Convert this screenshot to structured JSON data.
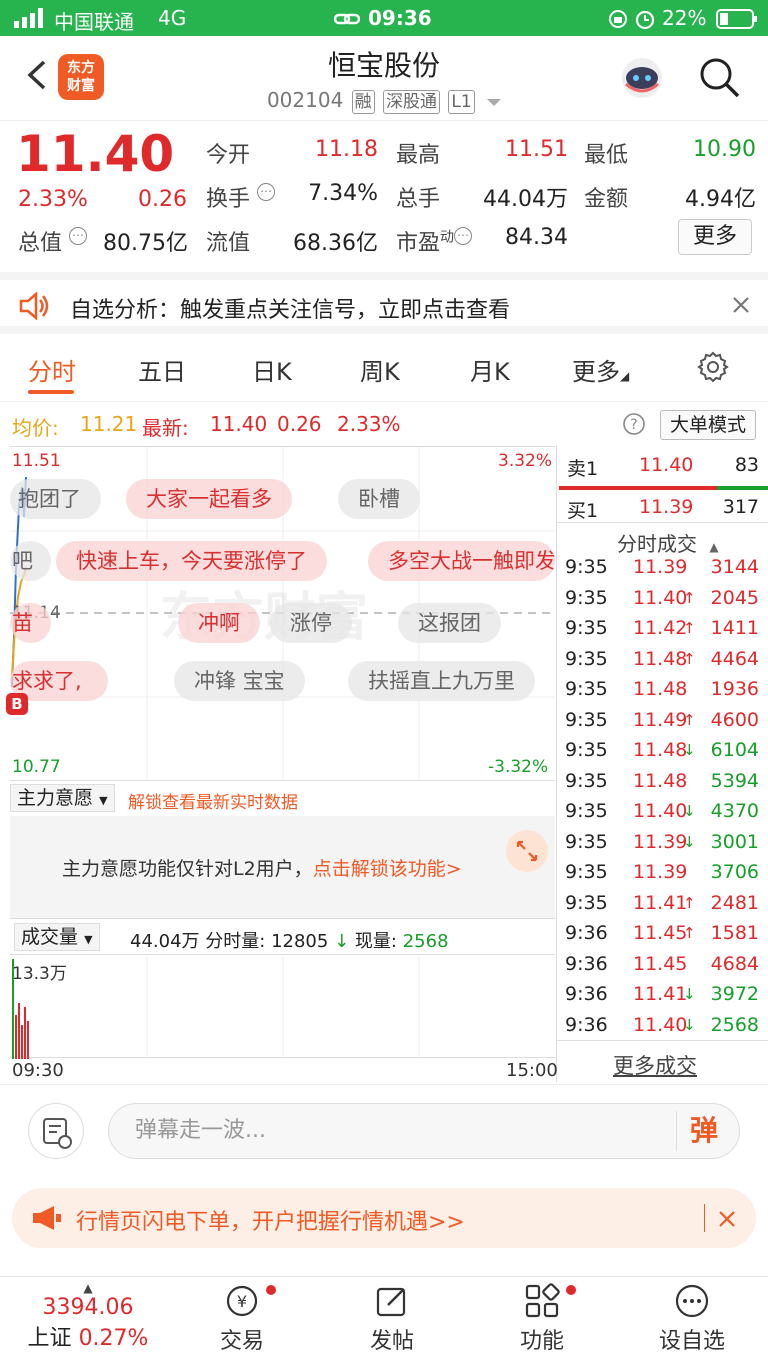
{
  "status": {
    "carrier": "中国联通",
    "network": "4G",
    "time": "09:36",
    "battery": "22%"
  },
  "header": {
    "logo_line1": "东方",
    "logo_line2": "财富",
    "title": "恒宝股份",
    "code": "002104",
    "tags": [
      "融",
      "深股通",
      "L1"
    ]
  },
  "quote": {
    "price": "11.40",
    "pct": "2.33%",
    "chg": "0.26",
    "rows": [
      [
        {
          "label": "今开",
          "value": "11.18",
          "color": "red"
        },
        {
          "label": "最高",
          "value": "11.51",
          "color": "red"
        },
        {
          "label": "最低",
          "value": "10.90",
          "color": "green"
        }
      ],
      [
        {
          "label": "换手",
          "value": "7.34%",
          "color": "black",
          "info": true
        },
        {
          "label": "总手",
          "value": "44.04万",
          "color": "black"
        },
        {
          "label": "金额",
          "value": "4.94亿",
          "color": "black"
        }
      ]
    ],
    "total_label": "总值",
    "total_value": "80.75亿",
    "float_label": "流值",
    "float_value": "68.36亿",
    "pe_label": "市盈",
    "pe_sup": "动",
    "pe_value": "84.34",
    "more_label": "更多"
  },
  "analysis": {
    "text": "自选分析：触发重点关注信号，立即点击查看"
  },
  "tabs": [
    {
      "label": "分时",
      "active": true
    },
    {
      "label": "五日"
    },
    {
      "label": "日K"
    },
    {
      "label": "周K"
    },
    {
      "label": "月K"
    },
    {
      "label": "更多"
    }
  ],
  "avgline": {
    "avg_label": "均价:",
    "avg_value": "11.21",
    "last_label": "最新:",
    "last_value": "11.40",
    "last_chg": "0.26",
    "last_pct": "2.33%",
    "bigmode": "大单模式"
  },
  "chart": {
    "high": "11.51",
    "low": "10.77",
    "high_pct": "3.32%",
    "low_pct": "-3.32%",
    "mid": "11.14",
    "buy_marker": "B",
    "watermark": "东方财富",
    "danmu": [
      {
        "text": "抱团了",
        "style": "grey"
      },
      {
        "text": "大家一起看多",
        "style": "pink"
      },
      {
        "text": "卧槽",
        "style": "grey"
      },
      {
        "text": "吧",
        "style": "grey"
      },
      {
        "text": "快速上车，今天要涨停了",
        "style": "pink"
      },
      {
        "text": "多空大战一触即发",
        "style": "pink"
      },
      {
        "text": "苗",
        "style": "pink"
      },
      {
        "text": "冲啊",
        "style": "pink"
      },
      {
        "text": "涨停",
        "style": "grey"
      },
      {
        "text": "这报团",
        "style": "grey"
      },
      {
        "text": "求求了,",
        "style": "pink"
      },
      {
        "text": "冲锋  宝宝",
        "style": "grey"
      },
      {
        "text": "扶摇直上九万里",
        "style": "grey"
      }
    ]
  },
  "book": {
    "sell_label": "卖1",
    "sell_price": "11.40",
    "sell_vol": "83",
    "buy_label": "买1",
    "buy_price": "11.39",
    "buy_vol": "317",
    "trades_title": "分时成交",
    "trades": [
      {
        "time": "9:35",
        "price": "11.39",
        "arrow": "",
        "vol": "3144",
        "pc": "red",
        "vc": "red"
      },
      {
        "time": "9:35",
        "price": "11.40",
        "arrow": "↑",
        "vol": "2045",
        "pc": "red",
        "vc": "red"
      },
      {
        "time": "9:35",
        "price": "11.42",
        "arrow": "↑",
        "vol": "1411",
        "pc": "red",
        "vc": "red"
      },
      {
        "time": "9:35",
        "price": "11.48",
        "arrow": "↑",
        "vol": "4464",
        "pc": "red",
        "vc": "red"
      },
      {
        "time": "9:35",
        "price": "11.48",
        "arrow": "",
        "vol": "1936",
        "pc": "red",
        "vc": "red"
      },
      {
        "time": "9:35",
        "price": "11.49",
        "arrow": "↑",
        "vol": "4600",
        "pc": "red",
        "vc": "red"
      },
      {
        "time": "9:35",
        "price": "11.48",
        "arrow": "↓",
        "vol": "6104",
        "pc": "red",
        "vc": "green"
      },
      {
        "time": "9:35",
        "price": "11.48",
        "arrow": "",
        "vol": "5394",
        "pc": "red",
        "vc": "green"
      },
      {
        "time": "9:35",
        "price": "11.40",
        "arrow": "↓",
        "vol": "4370",
        "pc": "red",
        "vc": "green"
      },
      {
        "time": "9:35",
        "price": "11.39",
        "arrow": "↓",
        "vol": "3001",
        "pc": "red",
        "vc": "green"
      },
      {
        "time": "9:35",
        "price": "11.39",
        "arrow": "",
        "vol": "3706",
        "pc": "red",
        "vc": "green"
      },
      {
        "time": "9:35",
        "price": "11.41",
        "arrow": "↑",
        "vol": "2481",
        "pc": "red",
        "vc": "red"
      },
      {
        "time": "9:36",
        "price": "11.45",
        "arrow": "↑",
        "vol": "1581",
        "pc": "red",
        "vc": "red"
      },
      {
        "time": "9:36",
        "price": "11.45",
        "arrow": "",
        "vol": "4684",
        "pc": "red",
        "vc": "red"
      },
      {
        "time": "9:36",
        "price": "11.41",
        "arrow": "↓",
        "vol": "3972",
        "pc": "red",
        "vc": "green"
      },
      {
        "time": "9:36",
        "price": "11.40",
        "arrow": "↓",
        "vol": "2568",
        "pc": "red",
        "vc": "green"
      }
    ],
    "more_trades": "更多成交"
  },
  "mainforce": {
    "label": "主力意愿",
    "unlock": "解锁查看最新实时数据",
    "notice": "主力意愿功能仅针对L2用户，",
    "notice_link": "点击解锁该功能>"
  },
  "volume": {
    "label": "成交量",
    "total": "44.04万",
    "minute_label": "分时量:",
    "minute_value": "12805",
    "now_label": "现量:",
    "now_value": "2568",
    "max": "13.3万",
    "start_time": "09:30",
    "end_time": "15:00"
  },
  "danmu_input": {
    "placeholder": "弹幕走一波...",
    "send": "弹"
  },
  "promo": {
    "text": "行情页闪电下单，开户把握行情机遇>>"
  },
  "nav": {
    "index_value": "3394.06",
    "index_name": "上证",
    "index_pct": "0.27%",
    "items": [
      "交易",
      "发帖",
      "功能",
      "设自选"
    ]
  }
}
